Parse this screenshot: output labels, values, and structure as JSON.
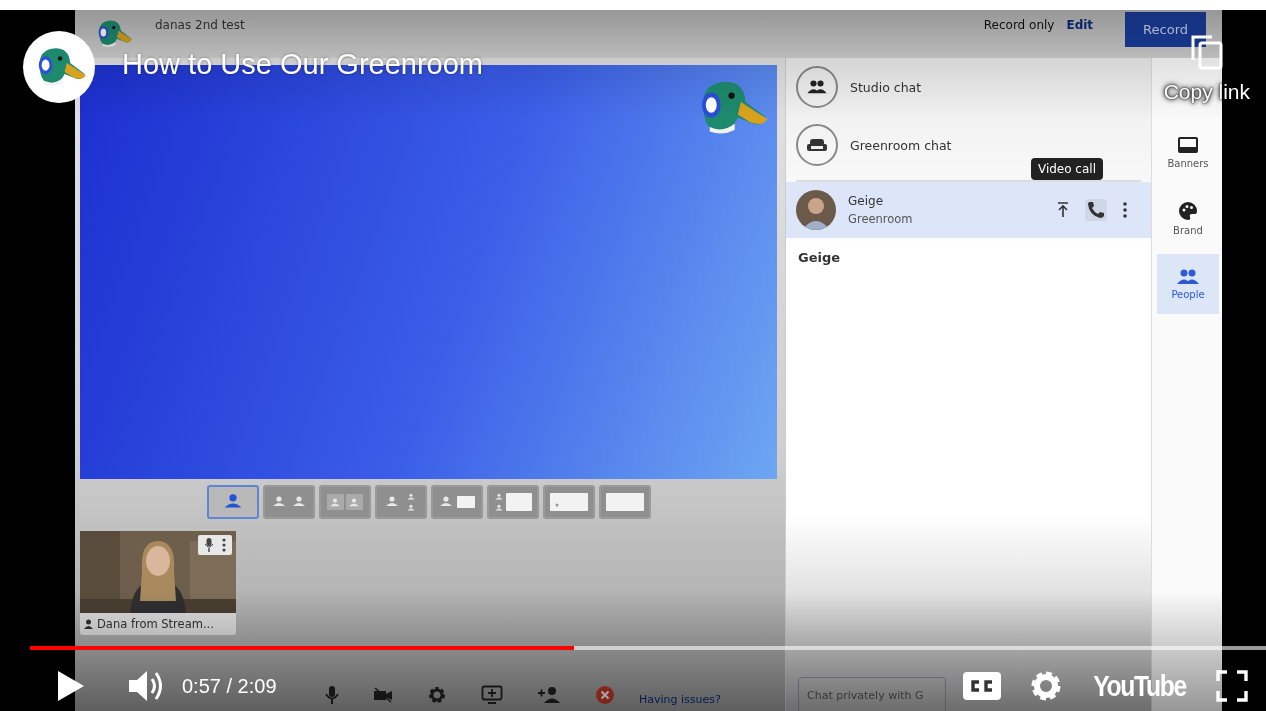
{
  "video": {
    "title": "How to Use Our Greenroom",
    "copy_link": "Copy link",
    "progress": {
      "level": 0.44
    },
    "time": "0:57 / 2:09",
    "logo": "YouTube"
  },
  "studio": {
    "name": "danas 2nd test",
    "record_mode": "Record only",
    "edit": "Edit",
    "record": "Record",
    "layouts": [
      {
        "kind": "solo",
        "selected": true
      },
      {
        "kind": "split",
        "selected": false
      },
      {
        "kind": "split-small",
        "selected": false
      },
      {
        "kind": "one-two",
        "selected": false
      },
      {
        "kind": "person-screen",
        "selected": false
      },
      {
        "kind": "two-screen",
        "selected": false
      },
      {
        "kind": "small-screen",
        "selected": false
      },
      {
        "kind": "screen",
        "selected": false
      }
    ],
    "participant": {
      "name": "Dana from Stream..."
    },
    "chats": [
      {
        "kind": "studio",
        "label": "Studio chat"
      },
      {
        "kind": "greenroom",
        "label": "Greenroom chat"
      }
    ],
    "person": {
      "name": "Geige",
      "location": "Greenroom",
      "tooltip": "Video call"
    },
    "section_title": "Geige",
    "chat_placeholder": "Chat privately with G",
    "help_link": "Having issues?",
    "rail": [
      {
        "kind": "banners",
        "label": "Banners",
        "selected": false
      },
      {
        "kind": "brand",
        "label": "Brand",
        "selected": false
      },
      {
        "kind": "people",
        "label": "People",
        "selected": true
      }
    ],
    "controls": [
      {
        "kind": "mic"
      },
      {
        "kind": "camera"
      },
      {
        "kind": "settings"
      },
      {
        "kind": "share"
      },
      {
        "kind": "invite"
      },
      {
        "kind": "leave"
      }
    ]
  }
}
